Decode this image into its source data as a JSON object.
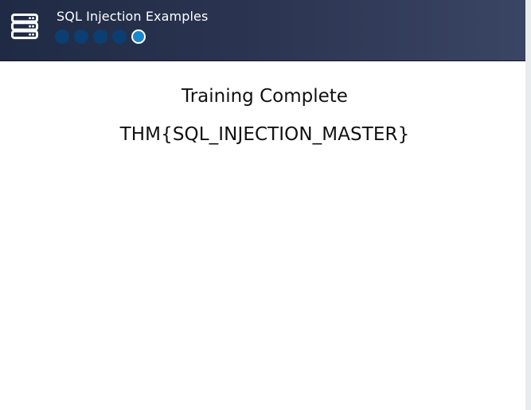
{
  "header": {
    "title": "SQL Injection Examples",
    "icon": "server-stack-icon",
    "progress": {
      "total_steps": 5,
      "current_step": 5,
      "completed_color": "#0b3f73",
      "active_color": "#1b86c8"
    }
  },
  "main": {
    "status_text": "Training Complete",
    "flag": "THM{SQL_INJECTION_MASTER}"
  },
  "colors": {
    "header_background": "#2a3450",
    "page_background": "#ffffff",
    "text_color": "#111111"
  }
}
